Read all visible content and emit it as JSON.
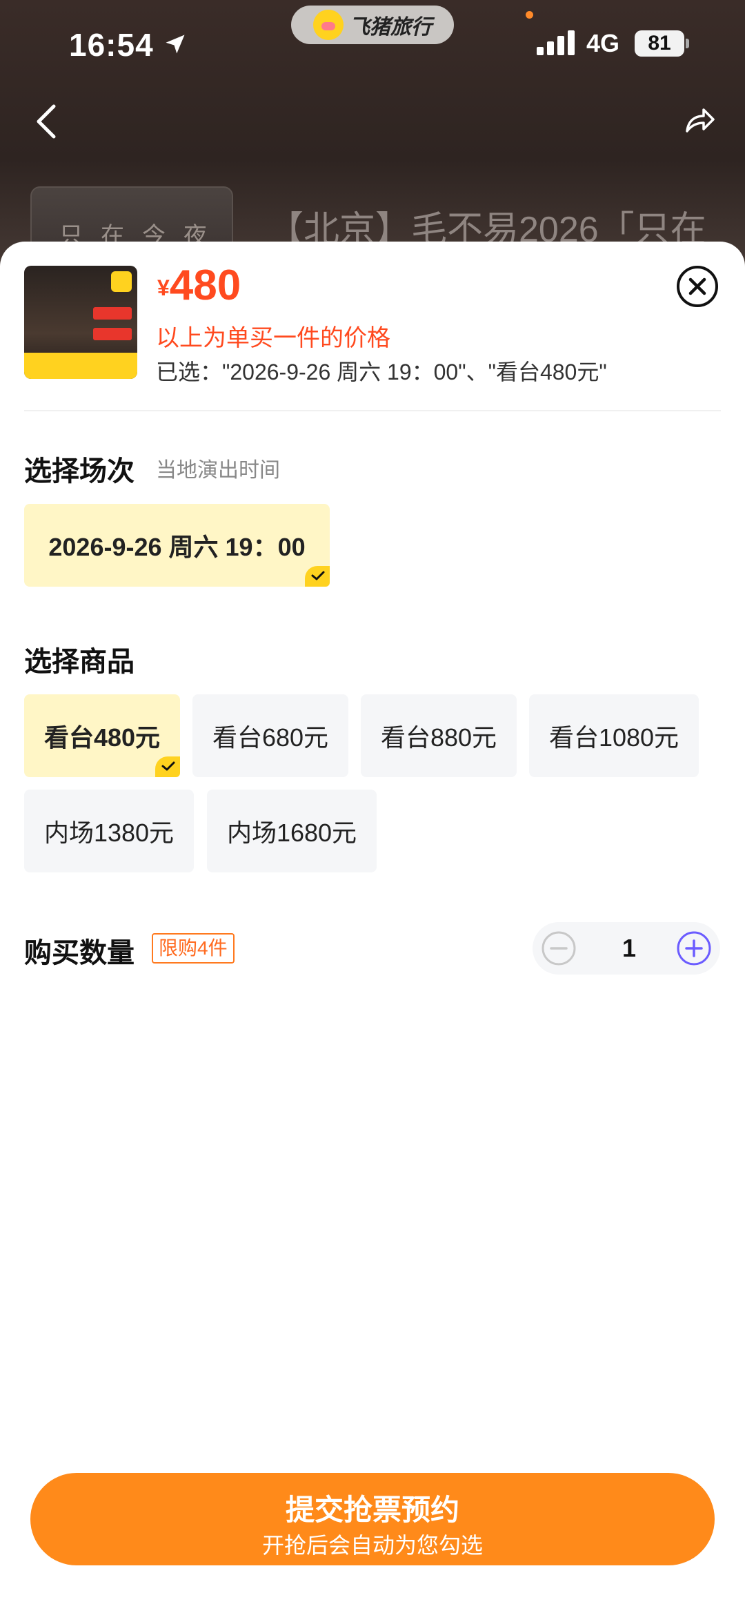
{
  "status_bar": {
    "time": "16:54",
    "app_name": "飞猪旅行",
    "network": "4G",
    "battery": "81"
  },
  "background": {
    "title": "【北京】毛不易2026「只在",
    "poster_text": "只在今夜"
  },
  "product": {
    "currency": "¥",
    "price": "480",
    "price_note": "以上为单买一件的价格",
    "selected_text": "已选：\"2026-9-26 周六 19：00\"、\"看台480元\""
  },
  "session": {
    "title": "选择场次",
    "subtitle": "当地演出时间",
    "options": [
      {
        "label": "2026-9-26 周六 19：00",
        "selected": true
      }
    ]
  },
  "goods": {
    "title": "选择商品",
    "options": [
      {
        "label": "看台480元",
        "selected": true
      },
      {
        "label": "看台680元",
        "selected": false
      },
      {
        "label": "看台880元",
        "selected": false
      },
      {
        "label": "看台1080元",
        "selected": false
      },
      {
        "label": "内场1380元",
        "selected": false
      },
      {
        "label": "内场1680元",
        "selected": false
      }
    ]
  },
  "quantity": {
    "title": "购买数量",
    "limit": "限购4件",
    "value": "1"
  },
  "submit": {
    "main": "提交抢票预约",
    "sub": "开抢后会自动为您勾选"
  },
  "colors": {
    "accent": "#ff8a1a",
    "price": "#ff4a1f",
    "selected_bg": "#fff6c6",
    "check": "#ffd21f",
    "stepper_plus": "#6b5cff"
  }
}
